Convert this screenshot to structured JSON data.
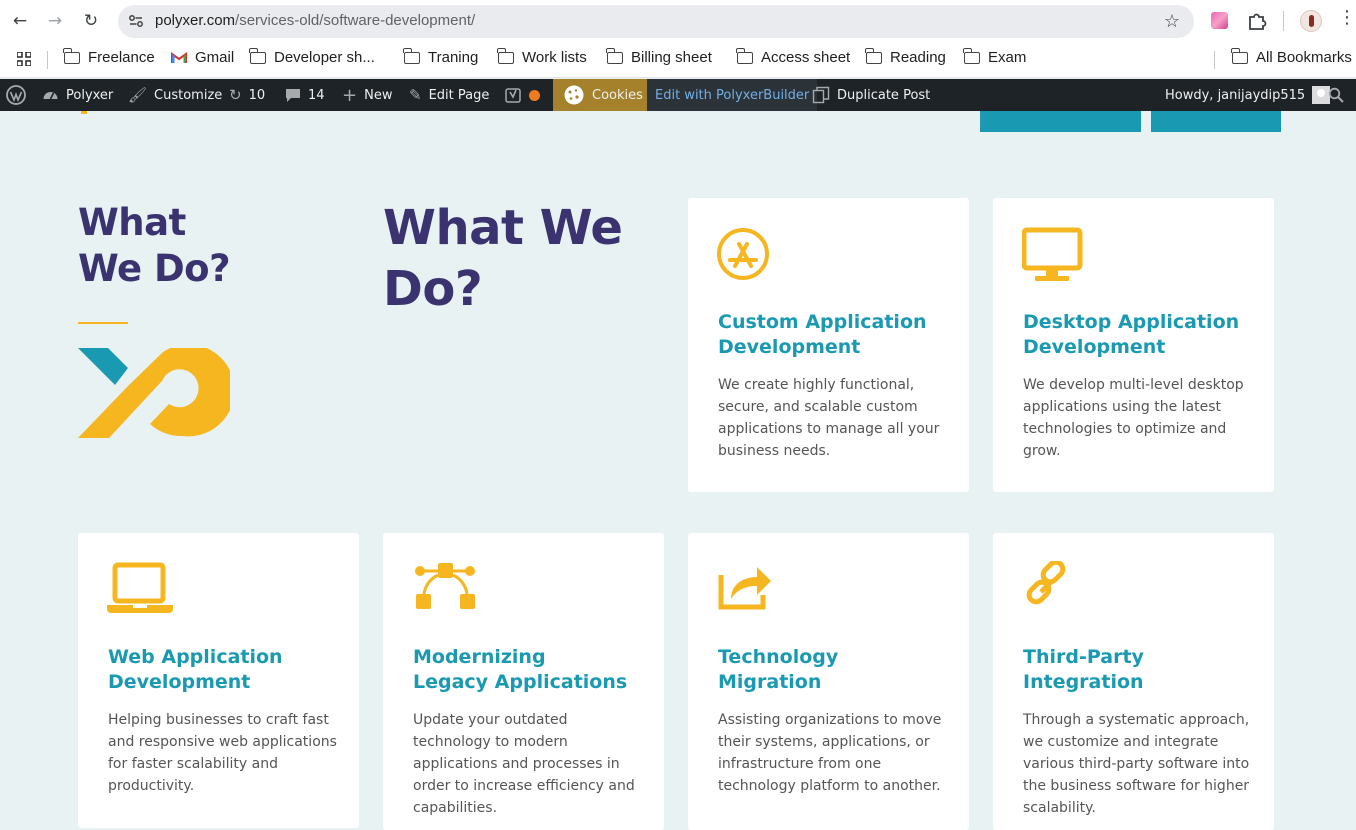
{
  "browser": {
    "url_domain": "polyxer.com",
    "url_path": "/services-old/software-development/"
  },
  "bookmarks": {
    "items": [
      {
        "label": "Freelance",
        "icon": "folder-icon"
      },
      {
        "label": "Gmail",
        "icon": "gmail-icon"
      },
      {
        "label": "Developer sh...",
        "icon": "folder-icon"
      },
      {
        "label": "Traning",
        "icon": "folder-icon"
      },
      {
        "label": "Work lists",
        "icon": "folder-icon"
      },
      {
        "label": "Billing sheet",
        "icon": "folder-icon"
      },
      {
        "label": "Access sheet",
        "icon": "folder-icon"
      },
      {
        "label": "Reading",
        "icon": "folder-icon"
      },
      {
        "label": "Exam",
        "icon": "folder-icon"
      }
    ],
    "all_bookmarks": "All Bookmarks"
  },
  "wpbar": {
    "site": "Polyxer",
    "customize": "Customize",
    "updates": "10",
    "comments": "14",
    "new": "New",
    "edit_page": "Edit Page",
    "cookies": "Cookies",
    "builder": "Edit with PolyxerBuilder",
    "duplicate": "Duplicate Post",
    "howdy": "Howdy, janijaydip515"
  },
  "section": {
    "left_title_line1": "What",
    "left_title_line2": "We Do?",
    "big_title_line1": "What We",
    "big_title_line2": "Do?"
  },
  "colors": {
    "accent_yellow": "#f5b620",
    "accent_teal": "#1a9ab2",
    "heading_purple": "#3a3370",
    "page_bg": "#e8f2f3"
  },
  "cards": [
    {
      "icon": "app-store-icon",
      "title_line1": "Custom Application",
      "title_line2": "Development",
      "desc": "We create highly functional, secure, and scalable custom applications to manage all your business needs."
    },
    {
      "icon": "desktop-icon",
      "title_line1": "Desktop Application",
      "title_line2": "Development",
      "desc": "We develop multi-level desktop applications using the latest technologies to optimize and grow."
    },
    {
      "icon": "laptop-icon",
      "title_line1": "Web Application",
      "title_line2": "Development",
      "desc": "Helping businesses to craft fast and responsive web applications for faster scalability and productivity."
    },
    {
      "icon": "vector-path-icon",
      "title_line1": "Modernizing",
      "title_line2": "Legacy Applications",
      "desc": "Update your outdated technology to modern applications and processes in order to increase efficiency and capabilities."
    },
    {
      "icon": "share-arrow-icon",
      "title_line1": "Technology",
      "title_line2": "Migration",
      "desc": "Assisting organizations to move their systems, applications, or infrastructure from one technology platform to another."
    },
    {
      "icon": "link-icon",
      "title_line1": "Third-Party",
      "title_line2": "Integration",
      "desc": "Through a systematic approach, we customize and integrate various third-party software into the business software for higher scalability."
    }
  ]
}
